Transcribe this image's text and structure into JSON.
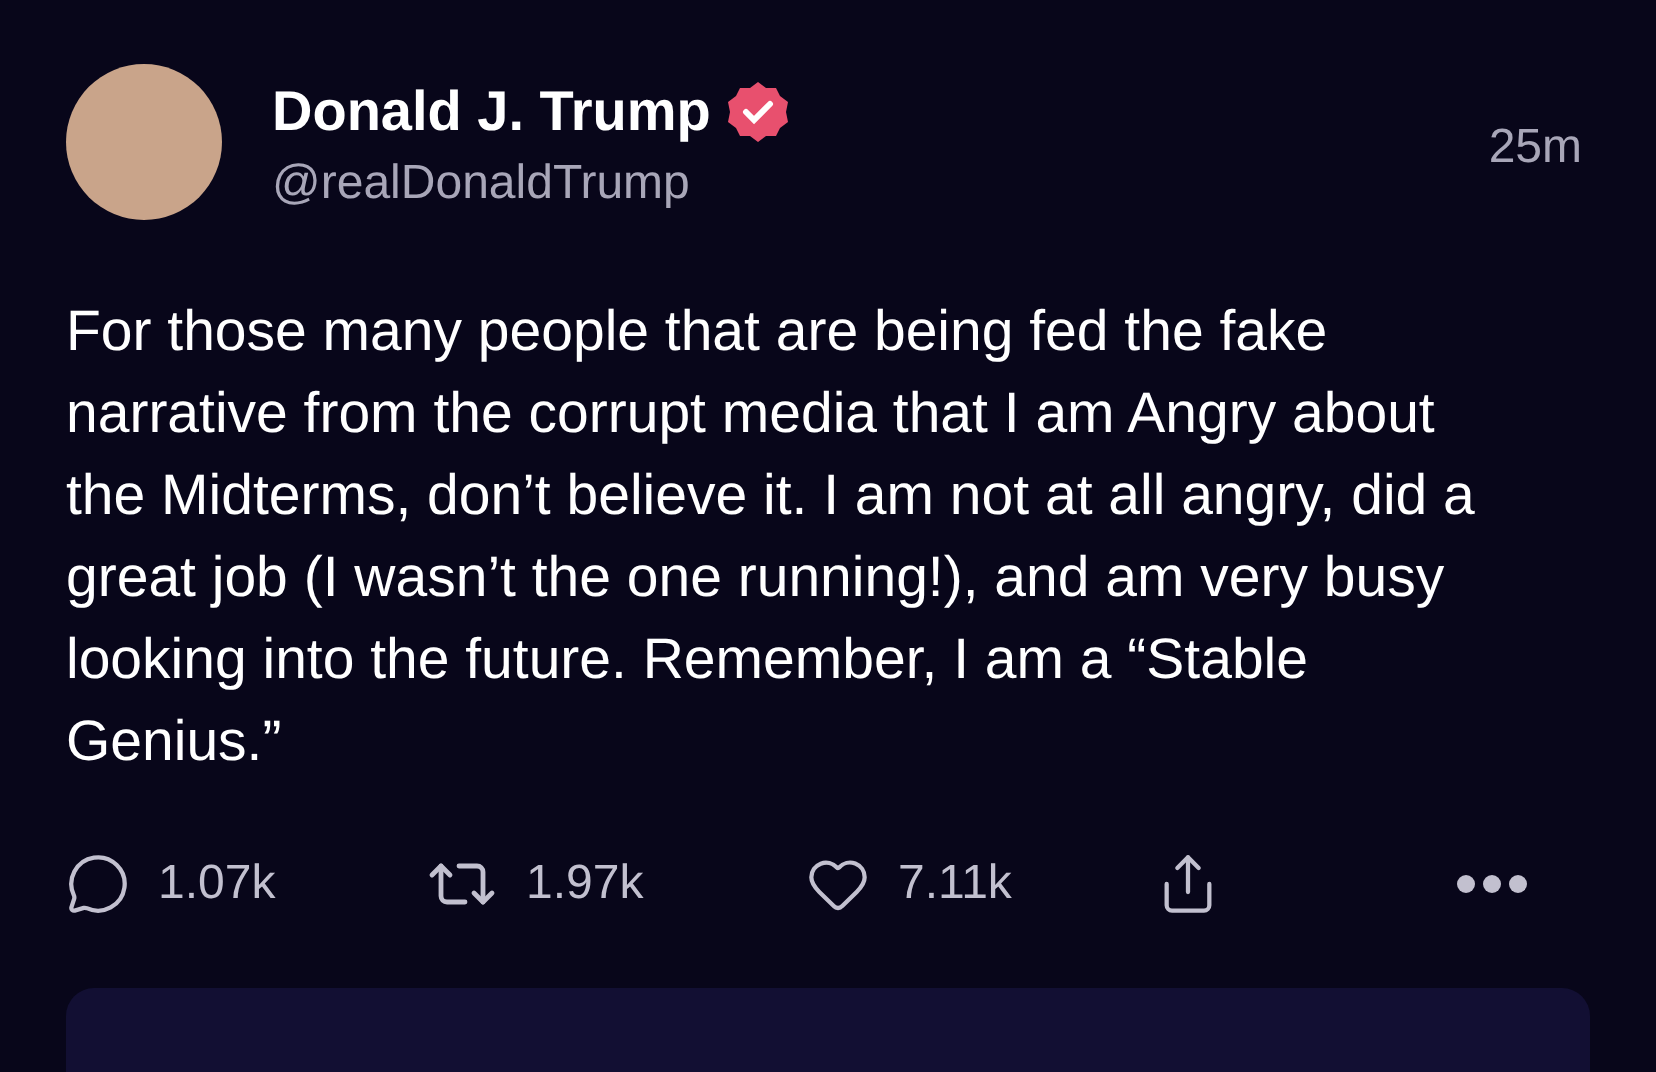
{
  "post": {
    "author": {
      "name": "Donald J. Trump",
      "verified": true,
      "handle": "@realDonaldTrump"
    },
    "time": "25m",
    "text": "For those many people that are being fed the fake narrative from the corrupt media that I am Angry about the Midterms, don’t believe it. I am not at all angry, did a great job (I wasn’t the one running!), and am very busy looking into the future. Remember, I am a “Stable Genius.”",
    "actions": [
      {
        "kind": "reply",
        "count": "1.07k"
      },
      {
        "kind": "repost",
        "count": "1.97k"
      },
      {
        "kind": "like",
        "count": "7.11k"
      },
      {
        "kind": "share"
      },
      {
        "kind": "more"
      }
    ]
  }
}
